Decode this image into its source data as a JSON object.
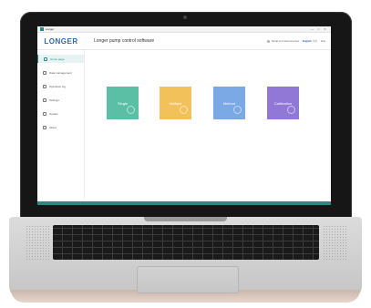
{
  "window": {
    "title": "Longer",
    "controls": [
      "—",
      "□",
      "✕"
    ]
  },
  "header": {
    "logo": "LONGER",
    "app_title": "Longer pump control software",
    "connection_label": "Serial port disconnected",
    "language_active": "English",
    "language_other": "中文",
    "exit_label": "Exit"
  },
  "sidebar": {
    "items": [
      {
        "label": "Home page",
        "icon": "home-icon"
      },
      {
        "label": "Data management",
        "icon": "database-icon"
      },
      {
        "label": "Operation log",
        "icon": "log-icon"
      },
      {
        "label": "Settings",
        "icon": "gear-icon"
      },
      {
        "label": "System",
        "icon": "system-icon"
      },
      {
        "label": "About",
        "icon": "info-icon"
      }
    ]
  },
  "cards": [
    {
      "label": "Single",
      "color": "#5bbfa5"
    },
    {
      "label": "Multiple",
      "color": "#f2c15a"
    },
    {
      "label": "Method",
      "color": "#7aa9e6"
    },
    {
      "label": "Calibration",
      "color": "#9178d6"
    }
  ],
  "colors": {
    "accent": "#2c8a86",
    "brand": "#2e68b0"
  }
}
